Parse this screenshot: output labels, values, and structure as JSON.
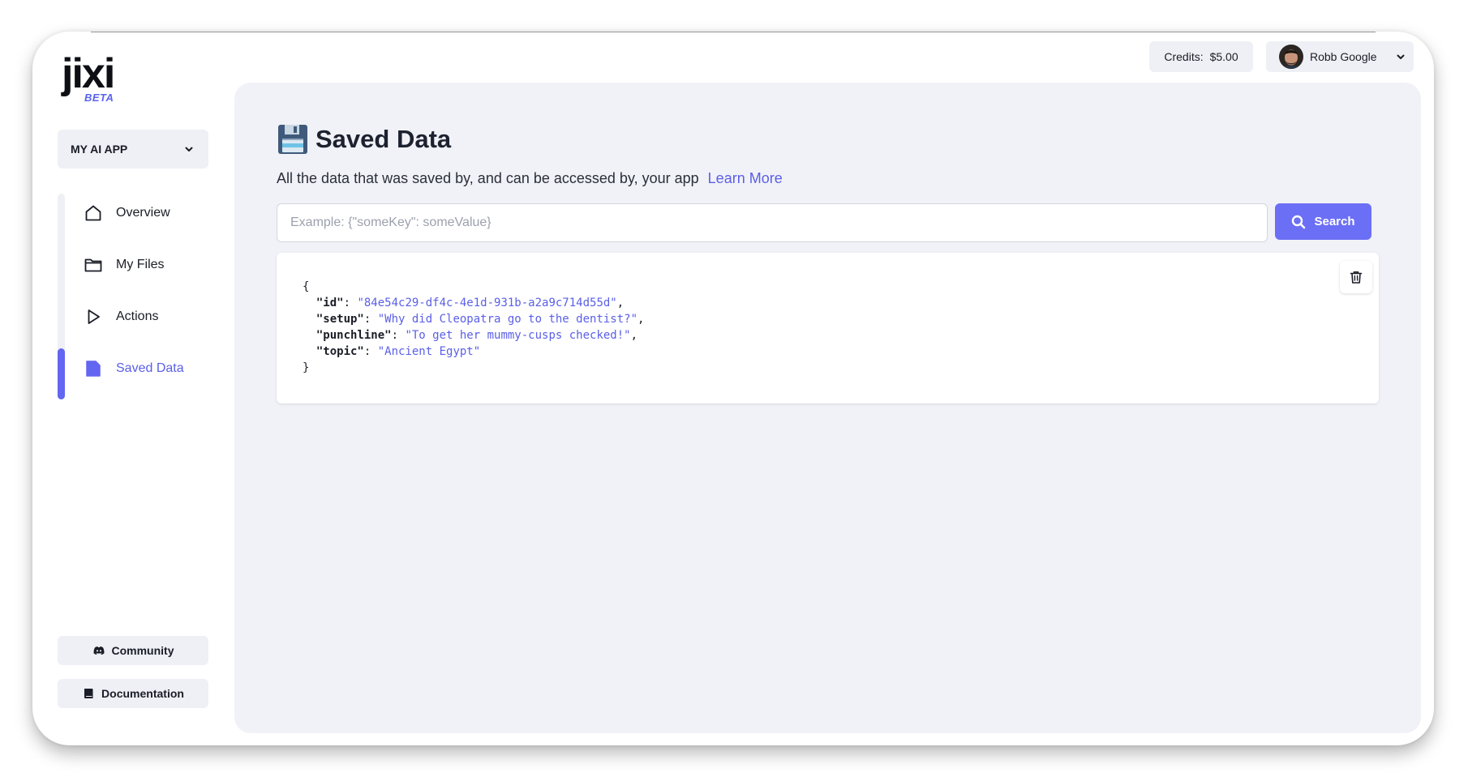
{
  "logo": {
    "word": "jixi",
    "badge": "BETA"
  },
  "sidebar": {
    "app_selector": {
      "label": "MY AI APP"
    },
    "nav": [
      {
        "label": "Overview",
        "icon": "home-icon"
      },
      {
        "label": "My Files",
        "icon": "folder-icon"
      },
      {
        "label": "Actions",
        "icon": "play-icon"
      },
      {
        "label": "Saved Data",
        "icon": "file-icon",
        "active": true
      }
    ],
    "community": {
      "label": "Community",
      "icon": "discord-icon"
    },
    "documentation": {
      "label": "Documentation",
      "icon": "book-icon"
    }
  },
  "header": {
    "credits": {
      "label": "Credits:",
      "value": "$5.00"
    },
    "user": {
      "name": "Robb Google"
    }
  },
  "main": {
    "title": "Saved Data",
    "title_icon": "floppy-disk-icon",
    "subtitle": "All the data that was saved by, and can be accessed by, your app",
    "learn_more": "Learn More",
    "search": {
      "placeholder": "Example: {\"someKey\": someValue}",
      "value": "",
      "button_label": "Search"
    },
    "records": [
      {
        "open_brace": "{",
        "close_brace": "}",
        "fields": [
          {
            "key": "\"id\"",
            "value": "\"84e54c29-df4c-4e1d-931b-a2a9c714d55d\"",
            "sep": ","
          },
          {
            "key": "\"setup\"",
            "value": "\"Why did Cleopatra go to the dentist?\"",
            "sep": ","
          },
          {
            "key": "\"punchline\"",
            "value": "\"To get her mummy-cusps checked!\"",
            "sep": ","
          },
          {
            "key": "\"topic\"",
            "value": "\"Ancient Egypt\"",
            "sep": ""
          }
        ]
      }
    ]
  },
  "colors": {
    "accent": "#6366f1",
    "panel_bg": "#f1f2f7",
    "chip_bg": "#eef0f5"
  }
}
